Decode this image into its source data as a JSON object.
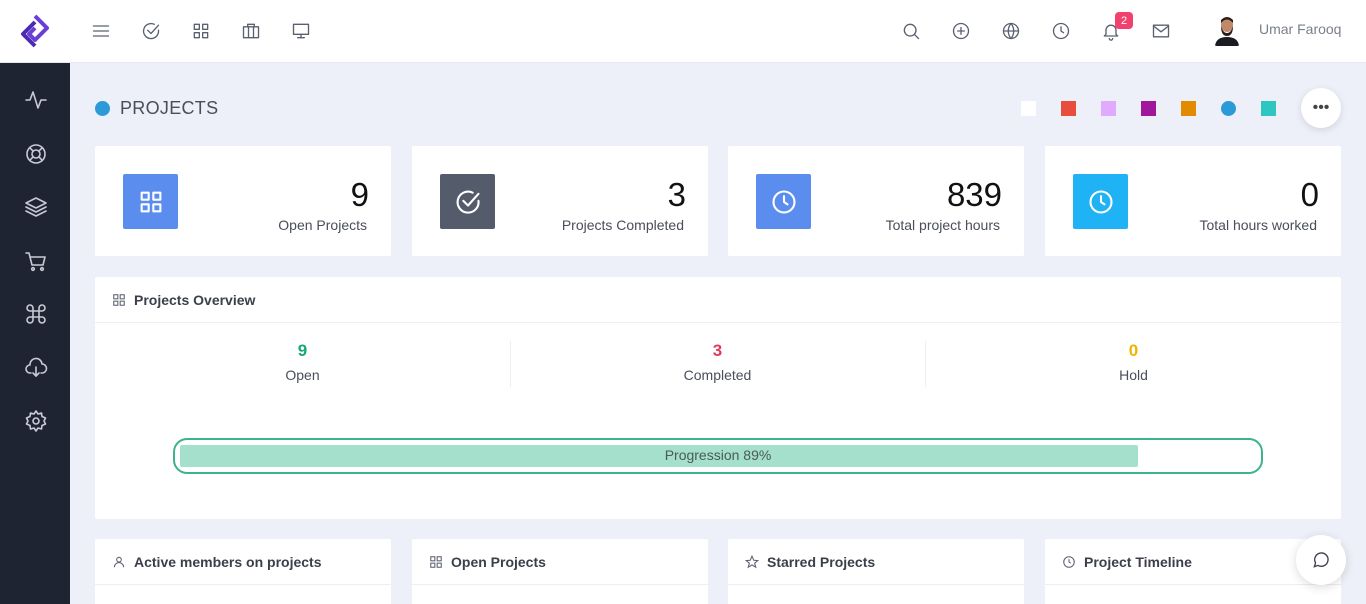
{
  "user": {
    "name": "Umar Farooq"
  },
  "notifications": {
    "count": "2"
  },
  "page": {
    "title": "PROJECTS"
  },
  "theme_swatches": [
    "#ffffff",
    "#e74c3c",
    "#e0aaff",
    "#a0179c",
    "#e28a00",
    "#2d9ad8",
    "#2ec6c0"
  ],
  "stats": [
    {
      "value": "9",
      "label": "Open Projects",
      "color": "#5b8def",
      "icon": "grid-icon"
    },
    {
      "value": "3",
      "label": "Projects Completed",
      "color": "#545b6b",
      "icon": "check-circle-icon"
    },
    {
      "value": "839",
      "label": "Total project hours",
      "color": "#5b8def",
      "icon": "clock-icon"
    },
    {
      "value": "0",
      "label": "Total hours worked",
      "color": "#1fb3f5",
      "icon": "clock-icon"
    }
  ],
  "overview": {
    "title": "Projects Overview",
    "columns": [
      {
        "value": "9",
        "label": "Open",
        "color": "#18a77a"
      },
      {
        "value": "3",
        "label": "Completed",
        "color": "#e23a5b"
      },
      {
        "value": "0",
        "label": "Hold",
        "color": "#f0b400"
      }
    ],
    "progress": {
      "label": "Progression 89%",
      "percent": 89
    }
  },
  "panels": [
    {
      "title": "Active members on projects",
      "icon": "user-icon"
    },
    {
      "title": "Open Projects",
      "icon": "grid-icon"
    },
    {
      "title": "Starred Projects",
      "icon": "star-icon"
    },
    {
      "title": "Project Timeline",
      "icon": "clock-icon"
    }
  ]
}
